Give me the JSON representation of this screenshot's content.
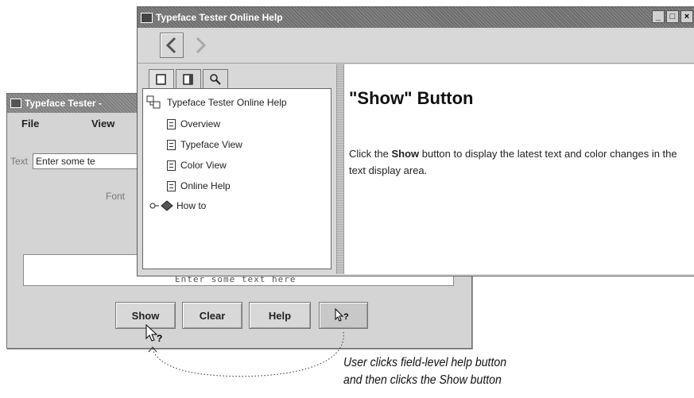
{
  "typeface_tester": {
    "title": "Typeface Tester -",
    "menu": [
      "File",
      "View"
    ],
    "text_label": "Text",
    "text_value": "Enter some te",
    "font_label": "Font",
    "display_text": "Enter some text here",
    "buttons": {
      "show": "Show",
      "clear": "Clear",
      "help": "Help",
      "whats_this": "k?"
    }
  },
  "help_window": {
    "title": "Typeface Tester Online Help",
    "window_buttons": [
      "_",
      "□",
      "×"
    ],
    "toolbar": {
      "back_icon": "chevron-left-icon",
      "forward_icon": "chevron-right-icon"
    },
    "tabs": [
      "toc-icon",
      "index-icon",
      "search-icon"
    ],
    "tree": {
      "root": "Typeface Tester Online Help",
      "items": [
        "Overview",
        "Typeface View",
        "Color View",
        "Online Help"
      ],
      "folder": "How to"
    },
    "content": {
      "heading": "\"Show\" Button",
      "body_before": "Click the ",
      "body_bold": "Show",
      "body_after": " button to display the latest text and color changes in the text display area."
    }
  },
  "annotation": {
    "line1": "User clicks field-level help button",
    "line2": "and then clicks the Show button"
  },
  "colors": {
    "titlebar": "#7e7e7e",
    "window_bg": "#d4d4d4",
    "content_bg": "#ffffff"
  }
}
